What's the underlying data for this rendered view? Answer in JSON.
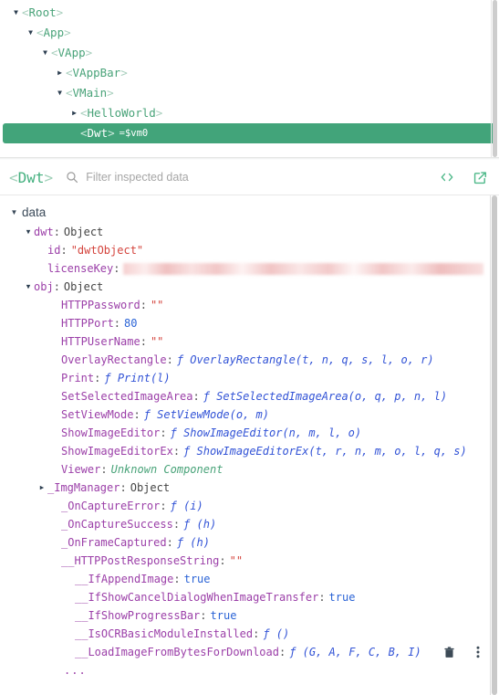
{
  "tree": {
    "nodes": [
      {
        "indent": 0,
        "arrow": "down",
        "name": "Root",
        "selected": false,
        "vm": ""
      },
      {
        "indent": 1,
        "arrow": "down",
        "name": "App",
        "selected": false,
        "vm": ""
      },
      {
        "indent": 2,
        "arrow": "down",
        "name": "VApp",
        "selected": false,
        "vm": ""
      },
      {
        "indent": 3,
        "arrow": "right",
        "name": "VAppBar",
        "selected": false,
        "vm": ""
      },
      {
        "indent": 3,
        "arrow": "down",
        "name": "VMain",
        "selected": false,
        "vm": ""
      },
      {
        "indent": 4,
        "arrow": "right",
        "name": "HelloWorld",
        "selected": false,
        "vm": ""
      },
      {
        "indent": 4,
        "arrow": "none",
        "name": "Dwt",
        "selected": true,
        "vm": "$vm0",
        "eq": "="
      }
    ]
  },
  "header": {
    "selected_tag_open": "<",
    "selected_tag_name": "Dwt",
    "selected_tag_close": ">",
    "filter_placeholder": "Filter inspected data",
    "filter_value": "",
    "search_icon": "search-icon",
    "code_icon": "code-brackets-icon",
    "open_external_icon": "open-in-new-icon"
  },
  "data_panel": {
    "section_label": "data",
    "section_arrow": "down",
    "rows": [
      {
        "indent": 1,
        "arrow": "down",
        "key": "dwt",
        "sep": ":",
        "value": "Object",
        "type": "object"
      },
      {
        "indent": 2,
        "arrow": "none",
        "key": "id",
        "sep": ":",
        "value": "\"dwtObject\"",
        "type": "string"
      },
      {
        "indent": 2,
        "arrow": "none",
        "key": "licenseKey",
        "sep": ":",
        "value": "",
        "type": "redacted",
        "redacted_width": 395
      },
      {
        "indent": 1,
        "arrow": "down",
        "key": "obj",
        "sep": ":",
        "value": "Object",
        "type": "object"
      },
      {
        "indent": 3,
        "arrow": "none",
        "key": "HTTPPassword",
        "sep": ":",
        "value": "\"\"",
        "type": "string"
      },
      {
        "indent": 3,
        "arrow": "none",
        "key": "HTTPPort",
        "sep": ":",
        "value": "80",
        "type": "number"
      },
      {
        "indent": 3,
        "arrow": "none",
        "key": "HTTPUserName",
        "sep": ":",
        "value": "\"\"",
        "type": "string"
      },
      {
        "indent": 3,
        "arrow": "none",
        "key": "OverlayRectangle",
        "sep": ":",
        "value": "OverlayRectangle(t, n, q, s, l, o, r)",
        "type": "function"
      },
      {
        "indent": 3,
        "arrow": "none",
        "key": "Print",
        "sep": ":",
        "value": "Print(l)",
        "type": "function"
      },
      {
        "indent": 3,
        "arrow": "none",
        "key": "SetSelectedImageArea",
        "sep": ":",
        "value": "SetSelectedImageArea(o, q, p, n, l)",
        "type": "function"
      },
      {
        "indent": 3,
        "arrow": "none",
        "key": "SetViewMode",
        "sep": ":",
        "value": "SetViewMode(o, m)",
        "type": "function"
      },
      {
        "indent": 3,
        "arrow": "none",
        "key": "ShowImageEditor",
        "sep": ":",
        "value": "ShowImageEditor(n, m, l, o)",
        "type": "function"
      },
      {
        "indent": 3,
        "arrow": "none",
        "key": "ShowImageEditorEx",
        "sep": ":",
        "value": "ShowImageEditorEx(t, r, n, m, o, l, q, s)",
        "type": "function"
      },
      {
        "indent": 3,
        "arrow": "none",
        "key": "Viewer",
        "sep": ":",
        "value": "Unknown Component",
        "type": "unknown"
      },
      {
        "indent": 2,
        "arrow": "right",
        "key": "_ImgManager",
        "sep": ":",
        "value": "Object",
        "type": "object"
      },
      {
        "indent": 3,
        "arrow": "none",
        "key": "_OnCaptureError",
        "sep": ":",
        "value": "(i)",
        "type": "function"
      },
      {
        "indent": 3,
        "arrow": "none",
        "key": "_OnCaptureSuccess",
        "sep": ":",
        "value": "(h)",
        "type": "function"
      },
      {
        "indent": 3,
        "arrow": "none",
        "key": "_OnFrameCaptured",
        "sep": ":",
        "value": "(h)",
        "type": "function"
      },
      {
        "indent": 3,
        "arrow": "none",
        "key": "__HTTPPostResponseString",
        "sep": ":",
        "value": "\"\"",
        "type": "string"
      },
      {
        "indent": 4,
        "arrow": "none",
        "key": "__IfAppendImage",
        "sep": ":",
        "value": "true",
        "type": "boolean"
      },
      {
        "indent": 4,
        "arrow": "none",
        "key": "__IfShowCancelDialogWhenImageTransfer",
        "sep": ":",
        "value": "true",
        "type": "boolean"
      },
      {
        "indent": 4,
        "arrow": "none",
        "key": "__IfShowProgressBar",
        "sep": ":",
        "value": "true",
        "type": "boolean"
      },
      {
        "indent": 4,
        "arrow": "none",
        "key": "__IsOCRBasicModuleInstalled",
        "sep": ":",
        "value": "()",
        "type": "function"
      },
      {
        "indent": 4,
        "arrow": "none",
        "key": "__LoadImageFromBytesForDownload",
        "sep": ":",
        "value": "(G, A, F, C, B, I)",
        "type": "function",
        "actions": [
          "delete-icon",
          "more-options-icon"
        ]
      },
      {
        "indent": 4,
        "arrow": "none",
        "key": "...",
        "sep": "",
        "value": "",
        "type": "ellipsis"
      }
    ]
  },
  "colors": {
    "selection_green": "#42a47a",
    "tag_green": "#49a379",
    "key_purple": "#9b3fa8",
    "string_red": "#d4443d",
    "number_blue": "#2a63d6",
    "function_blue": "#3253d6",
    "redaction_pink": "#f0c0c0"
  }
}
